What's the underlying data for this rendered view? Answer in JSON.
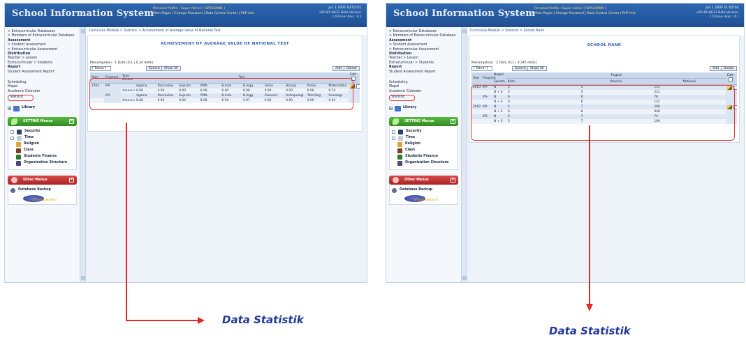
{
  "app": {
    "title": "School Information System",
    "profile_line": "Personal Profile : Super Admin [ SIPSADMIN ]",
    "links": "Main Pages | Change Password | Data Control Center | PHP Info",
    "date_left": "Jul. 1 2005 10:52:51",
    "date_right": "Jul. 1 2005 11:02:54",
    "version": "v60-85-8633 Beta Version",
    "online_users": "[ Online User : 4 ]"
  },
  "sidebar": {
    "items": [
      "> Extracurricular Databases",
      "> Members of Extracurricular Database",
      "Assessment",
      "> Student Assessment",
      "> Extracurricular Assessment",
      "Distribution",
      "Teacher > Lesson",
      "Extracurricular > Students",
      "Report",
      "Student Assessment Report"
    ],
    "items2": [
      "Scheduling",
      "Mapel",
      "Academic Calender",
      "Statistic"
    ],
    "library": "Library",
    "setting_menu": "SETTING Menus",
    "security": "Security",
    "time": "Time",
    "religion": "Religion",
    "class": "Class",
    "students_finance": "Students Finance",
    "organization_structure": "Organization Structure",
    "other_menu": "Other Menus",
    "database_backup": "Database Backup",
    "pma_logo": "phpMyAdmin"
  },
  "left": {
    "breadcrumb": "Curriculus Module > Statistic > Achievement of Average Value of National Test",
    "title": "ACHIEVEMENT OF AVERAGE VALUE OF NATIONAL TEST",
    "menampilkan": "Menampilkan : 1 Data (0,1 | 0,34 detik)",
    "select": "[ Tahun ]",
    "search": "Search",
    "show_all": "Show All",
    "add": "Add",
    "delete": "Delete",
    "headers": [
      "Year",
      "Program",
      "Type Assess",
      "Test",
      "Edit"
    ],
    "rows": [
      {
        "year": "2004",
        "program": "IPA",
        "type": "Assess ent",
        "subjects": [
          "Agama",
          "Pancasilas",
          "Sejarah",
          "PMN",
          "B.Indo",
          "B.Ingg",
          "Fisika",
          "Biologi",
          "Kimia",
          "Matematika"
        ],
        "values": [
          "8.08",
          "0.00",
          "0.00",
          "8.08",
          "6.40",
          "6.08",
          "0.00",
          "0.00",
          "0.00",
          "6.74"
        ]
      },
      {
        "year": "",
        "program": "IPS",
        "type": "Assess ent",
        "subjects": [
          "Agama",
          "Pancasilas",
          "Sejarah",
          "PMN",
          "B.Indo",
          "B.Ingg",
          "Ekonomi",
          "Antropologi",
          "Tata Neg",
          "Sosiologi"
        ],
        "values": [
          "8.08",
          "0.00",
          "0.00",
          "8.08",
          "6.50",
          "5.97",
          "0.00",
          "0.00",
          "0.00",
          "5.94"
        ]
      }
    ]
  },
  "right": {
    "breadcrumb": "Curriculus Module > Statistic > School Rank",
    "title": "SCHOOL RANK",
    "menampilkan": "Menampilkan : 2 Data (0,1 | 0,345 detik)",
    "select": "[ Tahun ]",
    "search": "Search",
    "show_all": "Show All",
    "add": "Add",
    "delete": "Delete",
    "headers": [
      "Year",
      "Program",
      "Negeri / Swasta",
      "Tingkat",
      "Edit"
    ],
    "sub_headers": [
      "Kota",
      "Provinsi",
      "National"
    ],
    "rows": [
      [
        "2003",
        "IPA",
        "N",
        "5",
        "5",
        "115"
      ],
      [
        "",
        "",
        "N + S",
        "5",
        "5",
        "212"
      ],
      [
        "",
        "IPS",
        "N",
        "6",
        "6",
        "78"
      ],
      [
        "",
        "",
        "N + S",
        "6",
        "6",
        "122"
      ],
      [
        "2002",
        "IPA",
        "N",
        "5",
        "7",
        "298"
      ],
      [
        "",
        "",
        "N + S",
        "6",
        "8",
        "448"
      ],
      [
        "",
        "IPS",
        "N",
        "5",
        "7",
        "74"
      ],
      [
        "",
        "",
        "N + S",
        "5",
        "7",
        "109"
      ]
    ]
  },
  "annotations": {
    "label_left": "Data Statistik",
    "label_right": "Data Statistik"
  },
  "colors": {
    "header_blue": "#2e67b0",
    "accent_red": "#e22727",
    "label_blue": "#23399a",
    "setting_green": "#3a9a2b",
    "other_red": "#c13535"
  }
}
